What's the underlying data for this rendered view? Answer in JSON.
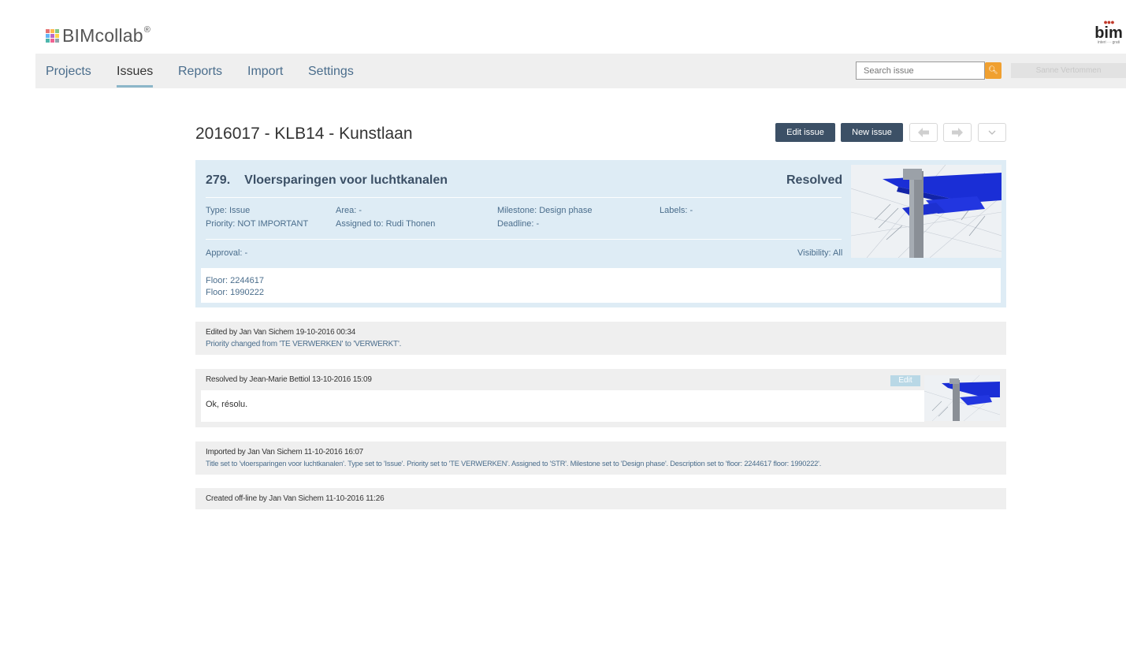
{
  "brand": {
    "name": "BIMcollab",
    "reg": "®",
    "partner_word": "bim",
    "partner_sub": "interi ··· grati"
  },
  "nav": {
    "items": [
      "Projects",
      "Issues",
      "Reports",
      "Import",
      "Settings"
    ],
    "active": "Issues",
    "search_placeholder": "Search issue",
    "search_icon": "search-icon",
    "user_name": "Sanne Vertommen"
  },
  "page": {
    "title": "2016017 - KLB14 - Kunstlaan",
    "edit_label": "Edit issue",
    "new_label": "New issue",
    "prev_icon": "arrow-left-icon",
    "next_icon": "arrow-right-icon",
    "more_icon": "chevron-down-icon"
  },
  "issue": {
    "number": "279.",
    "title": "Vloersparingen voor luchtkanalen",
    "status": "Resolved",
    "type": "Type: Issue",
    "priority": "Priority: NOT IMPORTANT",
    "area": "Area: -",
    "assigned": "Assigned to: Rudi Thonen",
    "milestone": "Milestone: Design phase",
    "deadline": "Deadline: -",
    "labels": "Labels: -",
    "approval": "Approval: -",
    "visibility": "Visibility: All",
    "floors": [
      "Floor: 2244617",
      "Floor: 1990222"
    ]
  },
  "history": {
    "edited_by": "Edited by Jan Van Sichem 19-10-2016 00:34",
    "edited_change": "Priority changed from 'TE VERWERKEN' to 'VERWERKT'.",
    "resolved_by": "Resolved by Jean-Marie Bettiol 13-10-2016 15:09",
    "resolved_comment": "Ok, résolu.",
    "resolved_edit": "Edit",
    "imported_by": "Imported by Jan Van Sichem 11-10-2016 16:07",
    "imported_change": "Title set to 'vloersparingen voor luchtkanalen'. Type set to 'Issue'. Priority set to 'TE VERWERKEN'. Assigned to 'STR'. Milestone set to 'Design phase'. Description set to 'floor: 2244617 floor: 1990222'.",
    "created_by": "Created off-line by Jan Van Sichem 11-10-2016 11:26"
  },
  "colors": {
    "accent_dark": "#3c5066",
    "link_blue": "#4a6d8c",
    "card_blue": "#deecf5",
    "search_orange": "#f0a030"
  }
}
